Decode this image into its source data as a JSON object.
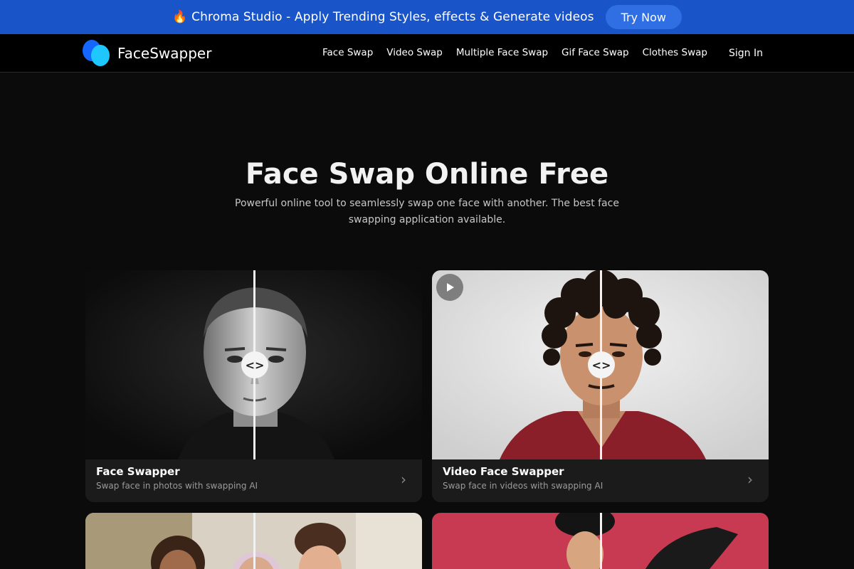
{
  "promo": {
    "fire_icon": "fire-icon",
    "text": "Chroma Studio - Apply Trending Styles, effects & Generate videos",
    "button": "Try Now"
  },
  "nav": {
    "brand": "FaceSwapper",
    "links": [
      "Face Swap",
      "Video Swap",
      "Multiple Face Swap",
      "Gif Face Swap",
      "Clothes Swap"
    ],
    "signin": "Sign In"
  },
  "hero": {
    "title": "Face Swap Online Free",
    "subtitle": "Powerful online tool to seamlessly swap one face with another. The best face swapping application available."
  },
  "cards": [
    {
      "title": "Face Swapper",
      "description": "Swap face in photos with swapping AI",
      "media": "black-and-white portrait of a man with a buzz cut",
      "has_play": false
    },
    {
      "title": "Video Face Swapper",
      "description": "Swap face in videos with swapping AI",
      "media": "man with curly hair in a red t-shirt on white background",
      "has_play": true
    }
  ],
  "colors": {
    "promo_bg": "#1a54c9",
    "button_bg": "#2f6ee3",
    "page_bg": "#0b0b0b",
    "card_bg": "#1b1b1b"
  }
}
